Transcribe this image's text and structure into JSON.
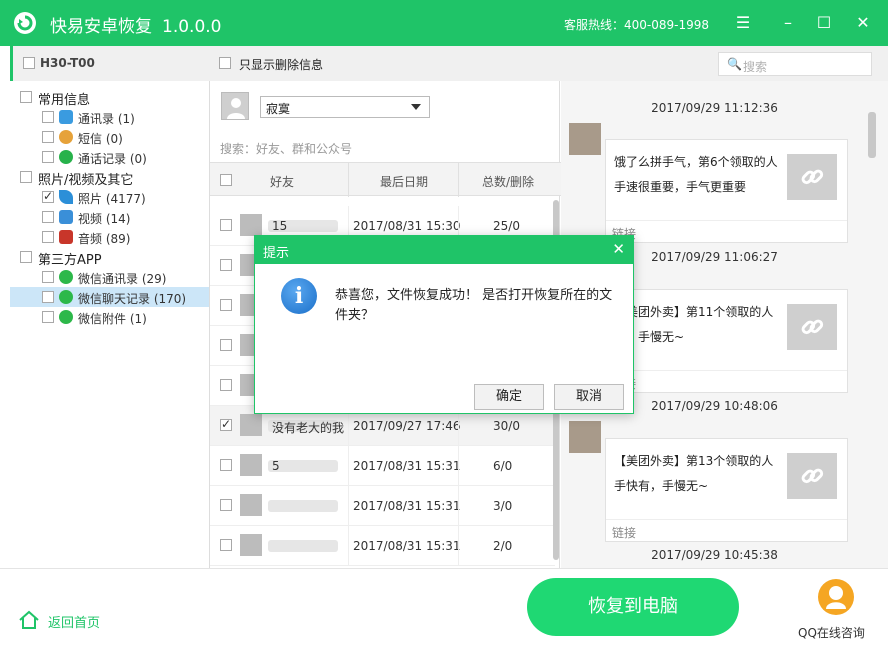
{
  "window": {
    "title": "快易安卓恢复",
    "version": "1.0.0.0",
    "hotline": "客服热线：400-089-1998"
  },
  "left": {
    "device": "H30-T00",
    "tree": [
      {
        "category": "常用信息",
        "items": [
          {
            "label": "通讯录 (1)",
            "icon": "contacts-icon",
            "checked": false
          },
          {
            "label": "短信 (0)",
            "icon": "sms-icon",
            "checked": false
          },
          {
            "label": "通话记录 (0)",
            "icon": "phone-icon",
            "checked": false
          }
        ]
      },
      {
        "category": "照片/视频及其它",
        "items": [
          {
            "label": "照片 (4177)",
            "icon": "photo-icon",
            "checked": true
          },
          {
            "label": "视频 (14)",
            "icon": "video-icon",
            "checked": false
          },
          {
            "label": "音频 (89)",
            "icon": "audio-icon",
            "checked": false
          }
        ]
      },
      {
        "category": "第三方APP",
        "items": [
          {
            "label": "微信通讯录 (29)",
            "icon": "wechat-icon",
            "checked": false
          },
          {
            "label": "微信聊天记录 (170)",
            "icon": "wechat-icon",
            "checked": false,
            "selected": true
          },
          {
            "label": "微信附件 (1)",
            "icon": "wechat-icon",
            "checked": false
          }
        ]
      }
    ]
  },
  "middle": {
    "show_deleted_label": "只显示删除信息",
    "contact_selected": "寂寞",
    "search_placeholder": "搜索：好友、群和公众号",
    "columns": [
      "好友",
      "最后日期",
      "总数/删除"
    ],
    "rows": [
      {
        "name": "15",
        "date": "2017/08/31 15:30",
        "count": "25/0",
        "checked": false
      },
      {
        "name": "",
        "date": "",
        "count": "",
        "checked": false
      },
      {
        "name": "",
        "date": "",
        "count": "",
        "checked": false
      },
      {
        "name": "",
        "date": "",
        "count": "",
        "checked": false
      },
      {
        "name": "",
        "date": "",
        "count": "",
        "checked": false
      },
      {
        "name": "没有老大的我",
        "date": "2017/09/27 17:46",
        "count": "30/0",
        "checked": true
      },
      {
        "name": "5",
        "date": "2017/08/31 15:31",
        "count": "6/0",
        "checked": false
      },
      {
        "name": "",
        "date": "2017/08/31 15:31",
        "count": "3/0",
        "checked": false
      },
      {
        "name": "",
        "date": "2017/08/31 15:31",
        "count": "2/0",
        "checked": false
      }
    ]
  },
  "right": {
    "search_placeholder": "搜索",
    "messages": [
      {
        "time": "2017/09/29 11:12:36",
        "text": "饿了么拼手气，第6个领取的人手速很重要，手气更重要",
        "footer": "链接"
      },
      {
        "time": "2017/09/29 11:06:27",
        "text": "【美团外卖】第11个领取的人有，手慢无~",
        "footer": "链接"
      },
      {
        "time": "2017/09/29 10:48:06",
        "text": "【美团外卖】第13个领取的人手快有，手慢无~",
        "footer": "链接"
      },
      {
        "time": "2017/09/29 10:45:38",
        "text": "",
        "footer": ""
      }
    ]
  },
  "footer": {
    "home_label": "返回首页",
    "recover_label": "恢复到电脑",
    "qq_label": "QQ在线咨询"
  },
  "dialog": {
    "title": "提示",
    "message": "恭喜您，文件恢复成功！ 是否打开恢复所在的文件夹？",
    "ok": "确定",
    "cancel": "取消"
  },
  "colors": {
    "brand_green": "#1fc468",
    "button_green": "#1fd873",
    "selection_blue": "#cce6f8"
  }
}
